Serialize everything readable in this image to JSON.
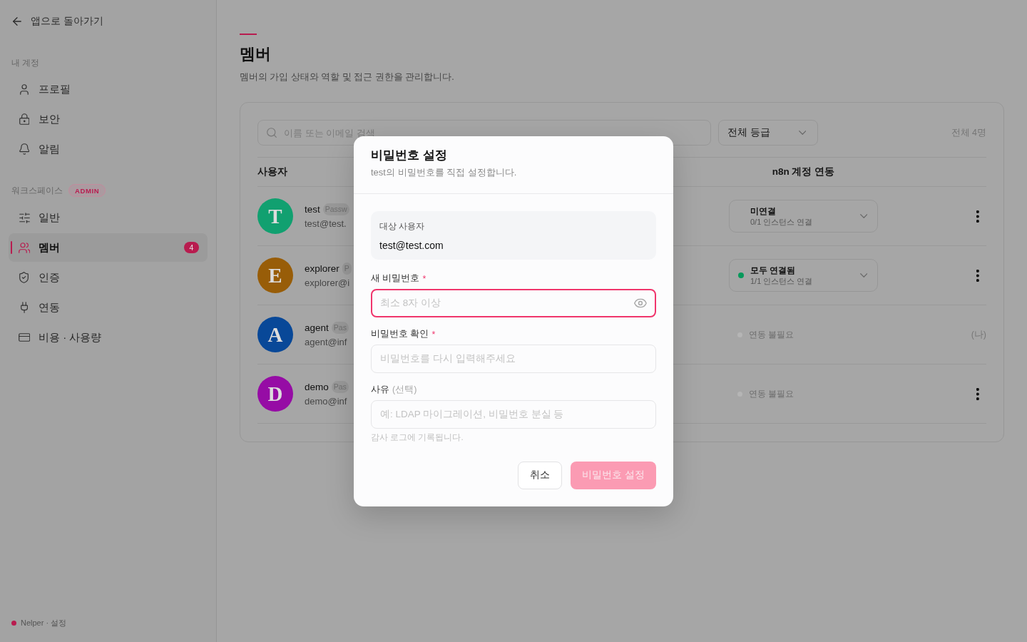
{
  "sidebar": {
    "back_link": "앱으로 돌아가기",
    "sections": [
      {
        "title": "내 계정",
        "items": [
          {
            "label": "프로필",
            "selected": false
          },
          {
            "label": "보안",
            "selected": false
          },
          {
            "label": "알림",
            "selected": false
          }
        ]
      },
      {
        "title": "워크스페이스",
        "badge": "ADMIN",
        "items": [
          {
            "label": "일반",
            "selected": false
          },
          {
            "label": "멤버",
            "selected": true,
            "count": "4"
          },
          {
            "label": "인증",
            "selected": false
          },
          {
            "label": "연동",
            "selected": false
          },
          {
            "label": "비용 · 사용량",
            "selected": false
          }
        ]
      }
    ],
    "footer": "Nelper · 설정"
  },
  "page": {
    "title": "멤버",
    "description": "멤버의 가입 상태와 역할 및 접근 권한을 관리합니다."
  },
  "toolbar": {
    "search": {
      "placeholder": "이름 또는 이메일 검색"
    },
    "role_filter": "전체 등급",
    "total": "전체 4명"
  },
  "table": {
    "columns": [
      "사용자",
      "n8n 계정 연동"
    ],
    "rows": [
      {
        "avatar": "T",
        "color": "#11a070",
        "name": "test",
        "tag": "Passw",
        "email": "test@test.",
        "n8n": {
          "kind": "select",
          "connected": false,
          "status": "미연결",
          "detail": "0/1 인스턴스 연결"
        },
        "action": {
          "kind": "menu"
        }
      },
      {
        "avatar": "E",
        "color": "#985d08",
        "name": "explorer",
        "tag": "P",
        "email": "explorer@i",
        "n8n": {
          "kind": "select",
          "connected": true,
          "status": "모두 연결됨",
          "detail": "1/1 인스턴스 연결"
        },
        "action": {
          "kind": "menu"
        }
      },
      {
        "avatar": "A",
        "color": "#084898",
        "name": "agent",
        "tag": "Pas",
        "email": "agent@inf",
        "n8n": {
          "kind": "static",
          "status": "연동 불필요"
        },
        "action": {
          "kind": "label",
          "text": "(나)"
        }
      },
      {
        "avatar": "D",
        "color": "#960ca5",
        "name": "demo",
        "tag": "Pas",
        "email": "demo@inf",
        "n8n": {
          "kind": "static",
          "status": "연동 불필요"
        },
        "action": {
          "kind": "menu"
        }
      }
    ]
  },
  "dialog": {
    "title": "비밀번호 설정",
    "subtitle": "test의 비밀번호를 직접 설정합니다.",
    "target": {
      "label": "대상 사용자",
      "value": "test@test.com"
    },
    "fields": [
      {
        "kind": "password",
        "label": "새 비밀번호",
        "required_mark": "*",
        "placeholder": "최소 8자 이상",
        "focused": true
      },
      {
        "kind": "text",
        "label": "비밀번호 확인",
        "required_mark": "*",
        "placeholder": "비밀번호를 다시 입력해주세요",
        "focused": false
      },
      {
        "kind": "text",
        "label": "사유",
        "note": "(선택)",
        "placeholder": "예: LDAP 마이그레이션, 비밀번호 분실 등",
        "hint": "감사 로그에 기록됩니다.",
        "focused": false
      }
    ],
    "buttons": [
      {
        "kind": "secondary",
        "label": "취소",
        "disabled": false
      },
      {
        "kind": "primary",
        "label": "비밀번호 설정",
        "disabled": true
      }
    ]
  }
}
